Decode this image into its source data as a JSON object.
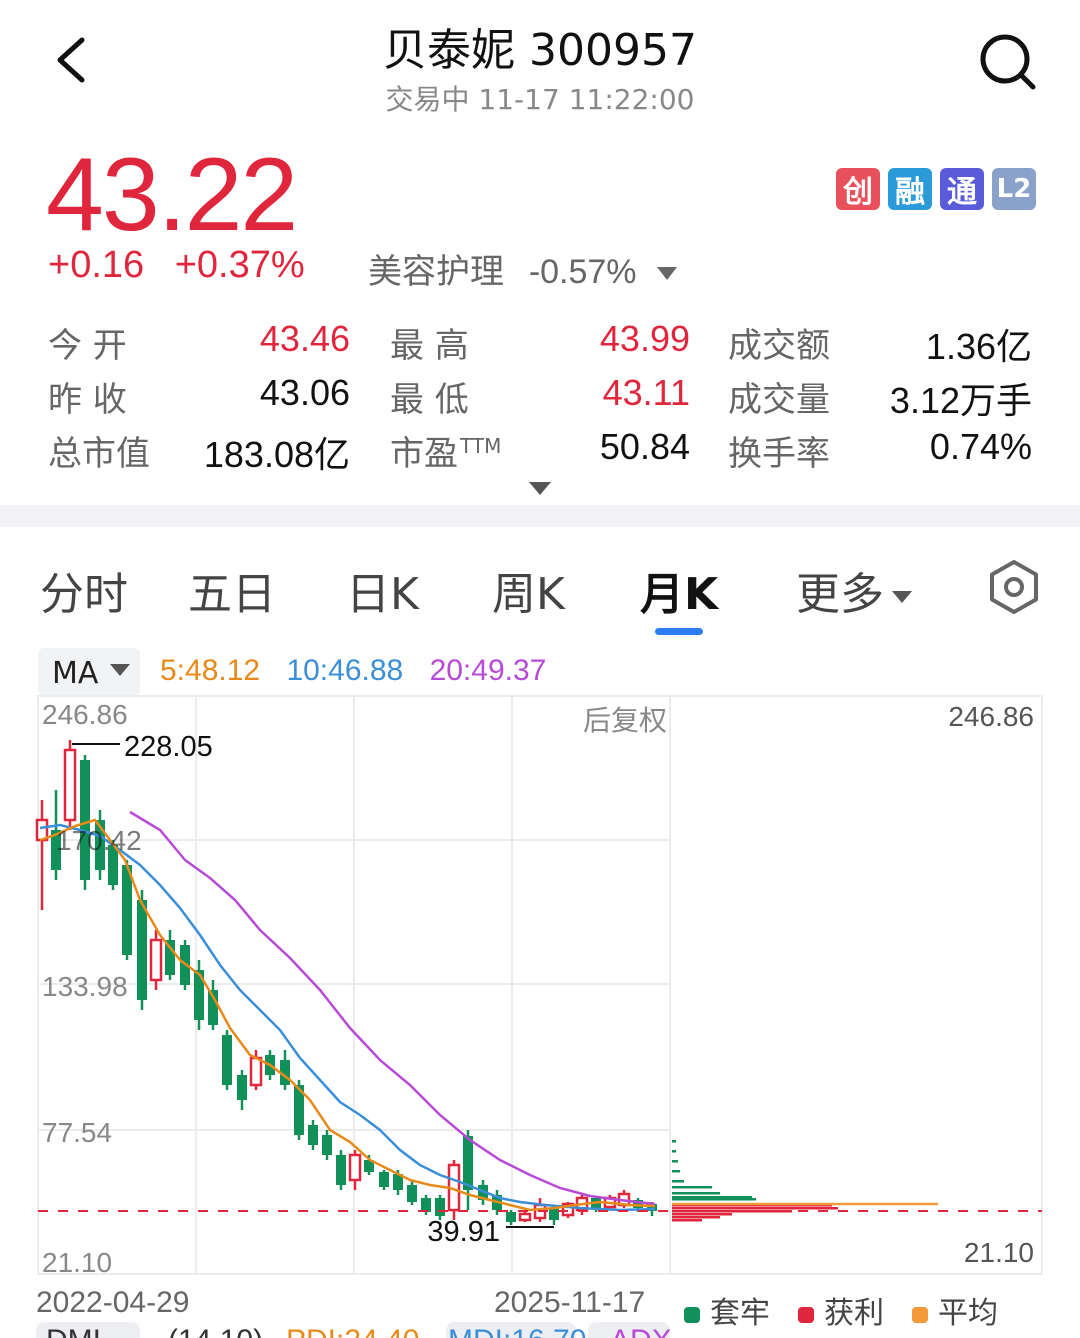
{
  "header": {
    "title": "贝泰妮 300957",
    "subtitle": "交易中 11-17 11:22:00"
  },
  "quote": {
    "price": "43.22",
    "change": "+0.16",
    "change_pct": "+0.37%",
    "industry_label": "美容护理",
    "industry_change": "-0.57%"
  },
  "badges": [
    {
      "label": "创",
      "color": "#e8505b"
    },
    {
      "label": "融",
      "color": "#2a9ad8"
    },
    {
      "label": "通",
      "color": "#5a5bd8"
    },
    {
      "label": "L2",
      "color": "#8aa1c9"
    }
  ],
  "stats": {
    "open_label": "今 开",
    "open": "43.46",
    "prev_close_label": "昨 收",
    "prev_close": "43.06",
    "mktcap_label": "总市值",
    "mktcap": "183.08亿",
    "high_label": "最 高",
    "high": "43.99",
    "low_label": "最 低",
    "low": "43.11",
    "pe_label": "市盈",
    "pe_sup": "TTM",
    "pe": "50.84",
    "amount_label": "成交额",
    "amount": "1.36亿",
    "volume_label": "成交量",
    "volume": "3.12万手",
    "turnover_label": "换手率",
    "turnover": "0.74%"
  },
  "tabs": [
    "分时",
    "五日",
    "日K",
    "周K",
    "月K",
    "更多"
  ],
  "active_tab": "月K",
  "ma": {
    "selector": "MA",
    "ma5": "5:48.12",
    "ma10": "10:46.88",
    "ma20": "20:49.37",
    "ma5_color": "#e88a1a",
    "ma10_color": "#3b8fd8",
    "ma20_color": "#b84ad8"
  },
  "chart_labels": {
    "top_left": "246.86",
    "top_right": "246.86",
    "mid1": "133.98",
    "mid2": "77.54",
    "bottom_left": "21.10",
    "bottom_right": "21.10",
    "adjust": "后复权",
    "max_marker": "228.05",
    "min_marker": "39.91",
    "cursor_marker": "170.42",
    "start_date": "2022-04-29",
    "end_date": "2025-11-17"
  },
  "legend": [
    {
      "label": "套牢",
      "color": "#11905a"
    },
    {
      "label": "获利",
      "color": "#e0263c"
    },
    {
      "label": "平均",
      "color": "#f39a3a"
    }
  ],
  "bottom_indicators": [
    "DMI",
    "(14,10)",
    "PDI:24.40",
    "MDI:16.70",
    "ADX"
  ],
  "colors": {
    "up": "#e0263c",
    "down": "#11905a",
    "accent": "#2d7cf0"
  }
}
